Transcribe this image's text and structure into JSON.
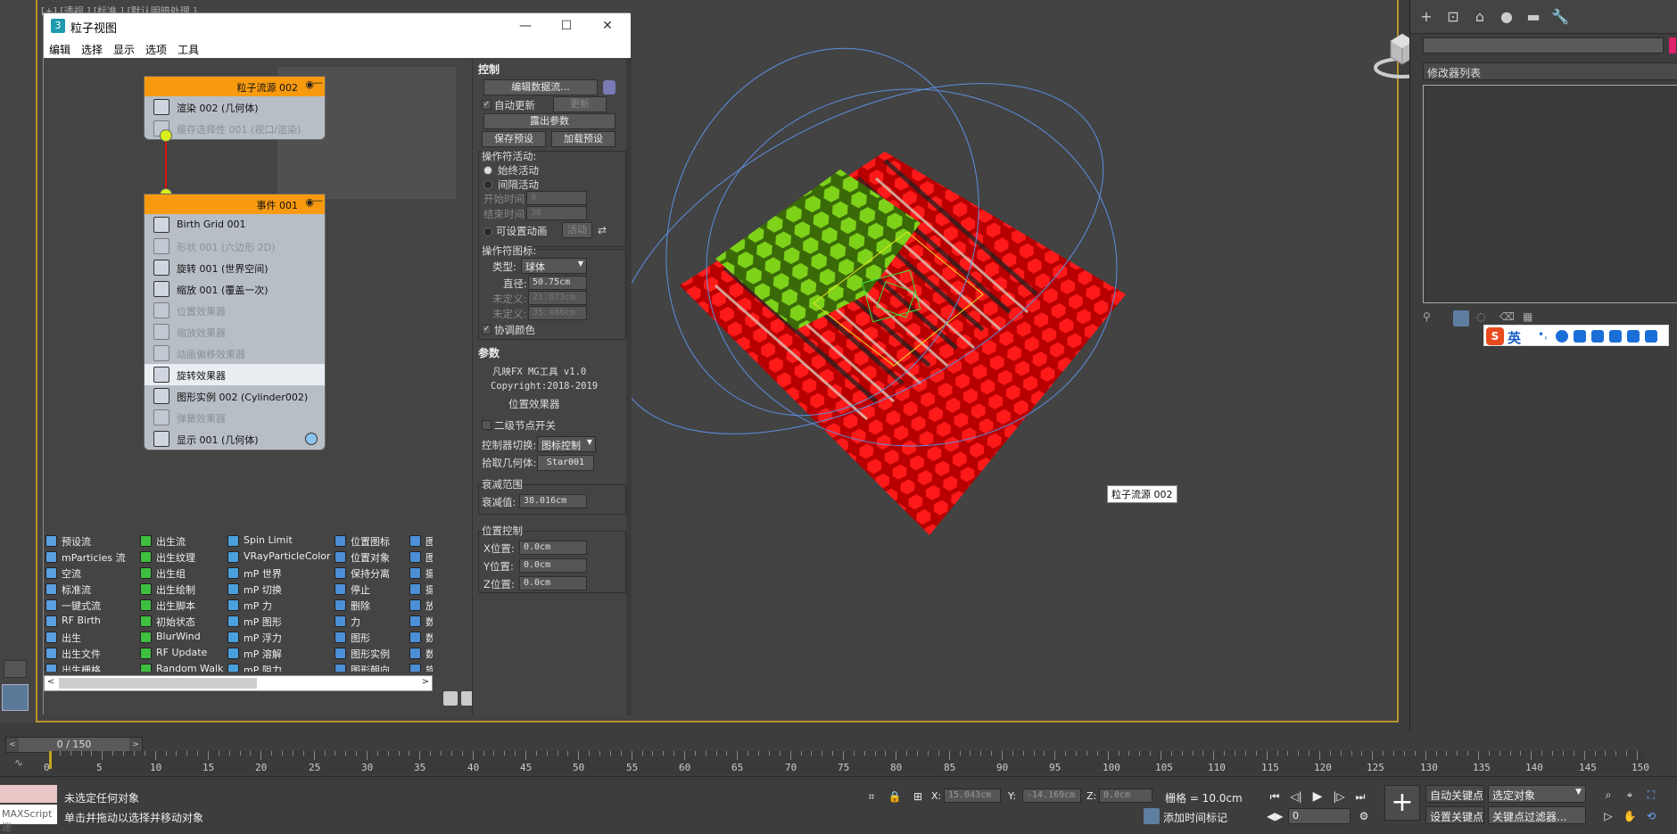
{
  "viewport": {
    "label": "[+] [透视 ] [标准 ] [默认明暗处理 ]",
    "tag": "粒子流源 002"
  },
  "particle_view": {
    "title": "粒子视图",
    "app_icon": "3",
    "window_buttons": [
      "—",
      "☐",
      "✕"
    ],
    "menu": [
      "编辑",
      "选择",
      "显示",
      "选项",
      "工具"
    ],
    "source_node": {
      "header": "粒子流源 002",
      "ops": [
        {
          "label": "渲染 002 (几何体)",
          "disabled": false
        },
        {
          "label": "缓存选择性 001 (视口/渲染)",
          "disabled": true
        }
      ]
    },
    "event_node": {
      "header": "事件 001",
      "ops": [
        {
          "label": "Birth Grid 001",
          "disabled": false
        },
        {
          "label": "形状 001 (六边形 2D)",
          "disabled": true
        },
        {
          "label": "旋转 001 (世界空间)",
          "disabled": false
        },
        {
          "label": "缩放 001 (覆盖一次)",
          "disabled": false
        },
        {
          "label": "位置效果器",
          "disabled": true
        },
        {
          "label": "缩放效果器",
          "disabled": true
        },
        {
          "label": "动画偏移效果器",
          "disabled": true
        },
        {
          "label": "旋转效果器",
          "disabled": false,
          "selected": true
        },
        {
          "label": "图形实例 002 (Cylinder002)",
          "disabled": false
        },
        {
          "label": "弹簧效果器",
          "disabled": true
        },
        {
          "label": "显示 001 (几何体)",
          "disabled": false
        }
      ]
    },
    "depot": {
      "columns": [
        [
          "预设流",
          "mParticles 流",
          "空流",
          "标准流",
          "一键式流",
          "RF Birth",
          "出生",
          "出生文件",
          "出生栅格"
        ],
        [
          "出生流",
          "出生纹理",
          "出生组",
          "出生绘制",
          "出生脚本",
          "初始状态",
          "BlurWind",
          "RF Update",
          "Random Walk"
        ],
        [
          "Spin Limit",
          "VRayParticleColor",
          "mP 世界",
          "mP 切换",
          "mP 力",
          "mP 图形",
          "mP 浮力",
          "mP 溶解",
          "mP 阻力"
        ],
        [
          "位置图标",
          "位置对象",
          "保持分离",
          "停止",
          "删除",
          "力",
          "图形",
          "图形实例",
          "图形朝向"
        ],
        [
          "图形标记",
          "图形快照",
          "摄影机",
          "摄影机消",
          "放置绘制",
          "数据图标",
          "数据操作",
          "数据预设",
          "旋转"
        ]
      ],
      "icon_colors": [
        "#5aa0e0",
        "#3fbf3f",
        "#4aa0dc",
        "#4d8fd6",
        "#4d8fd6"
      ]
    }
  },
  "control_panel": {
    "control_title": "控制",
    "edit_flow": "编辑数据流...",
    "auto_update": "自动更新",
    "update": "更新",
    "expose_params": "露出参数",
    "save_preset": "保存预设",
    "load_preset": "加载预设",
    "operator_activity": "操作符活动:",
    "always_active": "始终活动",
    "interval_active": "间隔活动",
    "start_time": "开始时间",
    "start_time_val": "0",
    "end_time": "结束时间",
    "end_time_val": "30",
    "animatable": "可设置动画",
    "activity": "活动",
    "operator_icon": "操作符图标:",
    "type_label": "类型:",
    "type_value": "球体",
    "diameter_label": "直径:",
    "diameter_value": "50.75cm",
    "undefined1_label": "未定义:",
    "undefined1_value": "21.873cm",
    "undefined2_label": "未定义:",
    "undefined2_value": "35.466cm",
    "coordinate_color": "协调颜色",
    "params_title": "参数",
    "plugin_name": "凡映FX  MG工具 v1.0",
    "copyright": "Copyright:2018-2019",
    "effector_name": "位置效果器",
    "secondary_switch": "二级节点开关",
    "controller_switch": "控制器切换:",
    "controller_value": "图标控制",
    "pick_geometry": "拾取几何体:",
    "pick_value": "Star001",
    "falloff_range": "衰减范围",
    "falloff_label": "衰减值:",
    "falloff_value": "38.016cm",
    "position_control": "位置控制",
    "x_label": "X位置:",
    "x_value": "0.0cm",
    "y_label": "Y位置:",
    "y_value": "0.0cm",
    "z_label": "Z位置:",
    "z_value": "0.0cm"
  },
  "command_panel": {
    "tabs": [
      "+",
      "⊡",
      "⌂",
      "●",
      "▬",
      "🔧"
    ],
    "modifier_list": "修改器列表"
  },
  "ime": {
    "logo": "S",
    "lang": "英"
  },
  "timeline": {
    "frame_counter": "0 / 150",
    "ticks": [
      0,
      5,
      10,
      15,
      20,
      25,
      30,
      35,
      40,
      45,
      50,
      55,
      60,
      65,
      70,
      75,
      80,
      85,
      90,
      95,
      100,
      105,
      110,
      115,
      120,
      125,
      130,
      135,
      140,
      145,
      150
    ]
  },
  "status": {
    "maxscript": "MAXScript 迷",
    "line1": "未选定任何对象",
    "line2": "单击并拖动以选择并移动对象",
    "x_label": "X:",
    "x_value": "15.043cm",
    "y_label": "Y:",
    "y_value": "-14.169cm",
    "z_label": "Z:",
    "z_value": "0.0cm",
    "grid": "栅格 = 10.0cm",
    "add_time_tag": "添加时间标记",
    "auto_key": "自动关键点",
    "set_key": "设置关键点",
    "selected_object": "选定对象",
    "key_filters": "关键点过滤器...",
    "frame_value": "0"
  }
}
